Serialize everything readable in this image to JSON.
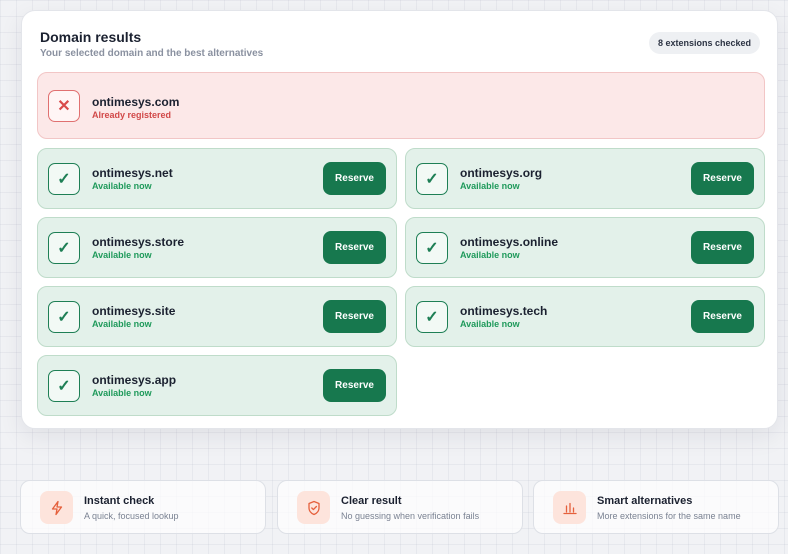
{
  "panel": {
    "title": "Domain results",
    "subtitle": "Your selected domain and the best alternatives",
    "badge": "8 extensions checked"
  },
  "selected": {
    "domain": "ontimesys.com",
    "status": "Already registered",
    "icon": "x-icon"
  },
  "alternatives": [
    {
      "domain": "ontimesys.net",
      "status": "Available now",
      "button": "Reserve"
    },
    {
      "domain": "ontimesys.org",
      "status": "Available now",
      "button": "Reserve"
    },
    {
      "domain": "ontimesys.store",
      "status": "Available now",
      "button": "Reserve"
    },
    {
      "domain": "ontimesys.online",
      "status": "Available now",
      "button": "Reserve"
    },
    {
      "domain": "ontimesys.site",
      "status": "Available now",
      "button": "Reserve"
    },
    {
      "domain": "ontimesys.tech",
      "status": "Available now",
      "button": "Reserve"
    },
    {
      "domain": "ontimesys.app",
      "status": "Available now",
      "button": "Reserve"
    }
  ],
  "features": [
    {
      "title": "Instant check",
      "subtitle": "A quick, focused lookup",
      "icon": "lightning-icon"
    },
    {
      "title": "Clear result",
      "subtitle": "No guessing when verification fails",
      "icon": "shield-check-icon"
    },
    {
      "title": "Smart alternatives",
      "subtitle": "More extensions for the same name",
      "icon": "bar-chart-icon"
    }
  ],
  "colors": {
    "accent": "#17784e",
    "available": "#1f9a5b",
    "taken": "#d14848",
    "feature_icon": "#e5603c"
  }
}
